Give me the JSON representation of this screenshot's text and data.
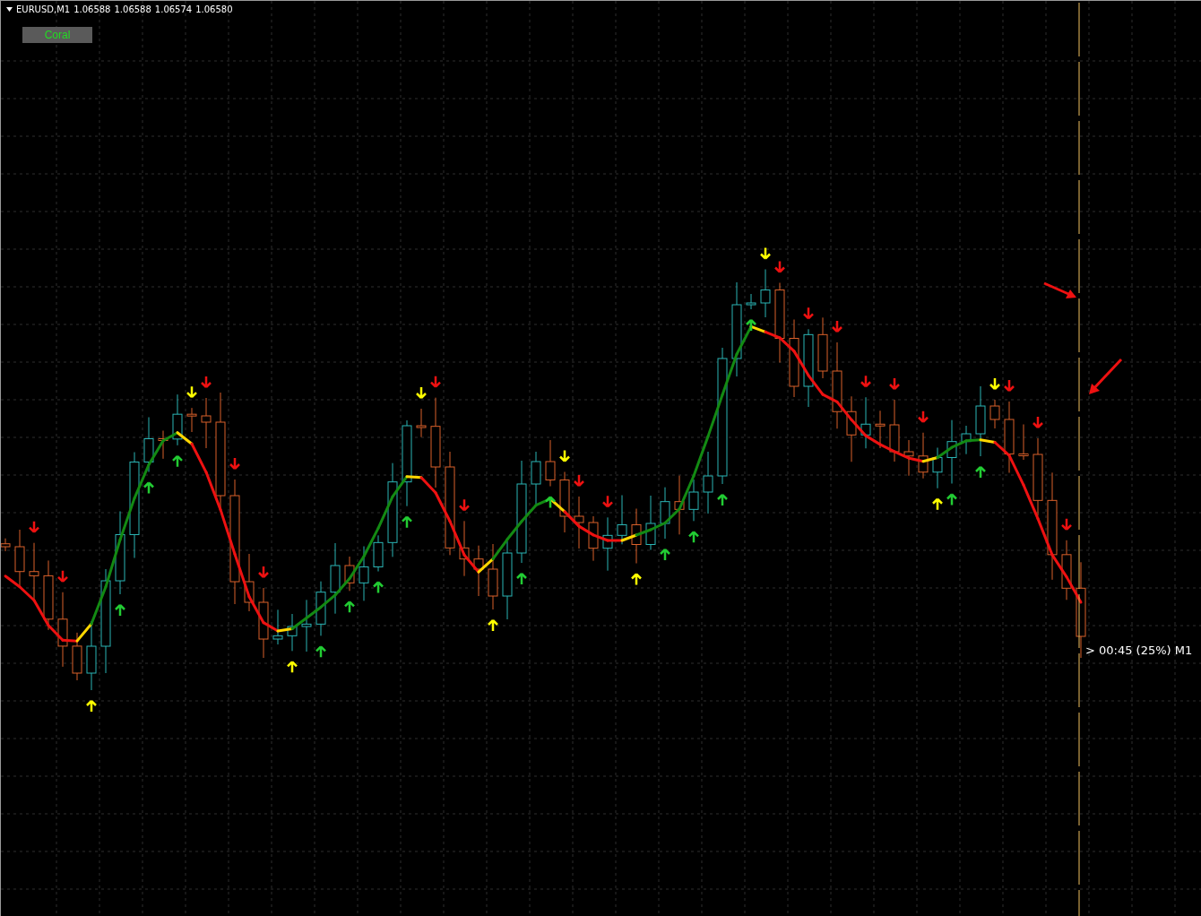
{
  "chart": {
    "symbol": "EURUSD,M1",
    "quotes": [
      "1.06588",
      "1.06588",
      "1.06574",
      "1.06580"
    ],
    "indicator_button": "Coral",
    "timer": "> 00:45 (25%) M1"
  }
}
